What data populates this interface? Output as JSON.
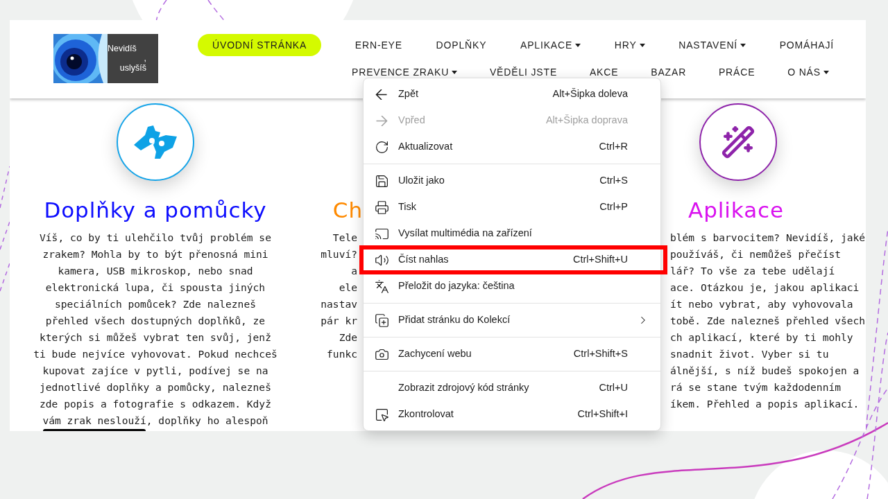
{
  "logo": {
    "lines": [
      "Nevidíš",
      ",",
      "uslyšíš"
    ]
  },
  "nav": {
    "first_line": [
      {
        "label": "ÚVODNÍ STRÁNKA",
        "selected": true,
        "dropdown": false
      },
      {
        "label": "ERN-EYE",
        "selected": false,
        "dropdown": false
      },
      {
        "label": "DOPLŇKY",
        "selected": false,
        "dropdown": false
      },
      {
        "label": "APLIKACE",
        "selected": false,
        "dropdown": true
      },
      {
        "label": "HRY",
        "selected": false,
        "dropdown": true
      },
      {
        "label": "NASTAVENÍ",
        "selected": false,
        "dropdown": true
      },
      {
        "label": "POMÁHAJÍ",
        "selected": false,
        "dropdown": false
      }
    ],
    "second_line": [
      {
        "label": "PREVENCE ZRAKU",
        "selected": false,
        "dropdown": true
      },
      {
        "label": "VĚDĚLI JSTE",
        "selected": false,
        "dropdown": false
      },
      {
        "label": "AKCE",
        "selected": false,
        "dropdown": false
      },
      {
        "label": "BAZAR",
        "selected": false,
        "dropdown": false
      },
      {
        "label": "PRÁCE",
        "selected": false,
        "dropdown": false
      },
      {
        "label": "O NÁS",
        "selected": false,
        "dropdown": true
      }
    ]
  },
  "columns": [
    {
      "kind": "full",
      "title": "Doplňky a pomůcky",
      "color": "#0d0dff",
      "lines": [
        "Víš, co by ti ulehčilo tvůj problém se",
        "zrakem? Mohla by to být přenosná mini",
        "kamera, USB mikroskop, nebo snad",
        "elektronická lupa, či spousta jiných",
        "speciálních pomůcek? Zde nalezneš",
        "přehled všech dostupných doplňků, ze",
        "kterých si můžeš vybrat ten svůj, jenž",
        "ti bude nejvíce vyhovovat. Pokud nechceš",
        "kupovat zajíce v pytli, podívej se na",
        "jednotlivé doplňky a pomůcky, nalezneš",
        "zde popis a fotografie s odkazem. Když",
        "vám zrak neslouží, doplňky ho alespoň"
      ]
    },
    {
      "kind": "cut-right",
      "title": "Ch",
      "color": "#ff8a00",
      "lines": [
        "Tele",
        "mluví?",
        "a",
        "ele",
        "nastav",
        "pár kr",
        "Zde",
        "funkc"
      ]
    },
    {
      "kind": "cut-left",
      "title": "Aplikace",
      "color": "#d912ef",
      "lines": [
        "blém s barvocitem? Nevidíš, jaké",
        "používáš, či nemůžeš přečíst",
        "lář? To vše za tebe udělají",
        "ace. Otázkou je, jakou aplikaci",
        "ít nebo vybrat, aby vyhovovala",
        "tobě. Zde nalezneš přehled všech",
        "ch aplikací, které by ti mohly",
        "snadnit život. Vyber si tu",
        "álnější, s níž budeš spokojen a",
        "rá se stane tvým každodenním",
        "íkem. Přehled a popis aplikací."
      ]
    }
  ],
  "context_menu": {
    "groups": [
      [
        {
          "label": "Zpět",
          "shortcut": "Alt+Šipka doleva",
          "disabled": false,
          "highlighted": false,
          "submenu": false
        },
        {
          "label": "Vpřed",
          "shortcut": "Alt+Šipka doprava",
          "disabled": true,
          "highlighted": false,
          "submenu": false
        },
        {
          "label": "Aktualizovat",
          "shortcut": "Ctrl+R",
          "disabled": false,
          "highlighted": false,
          "submenu": false
        }
      ],
      [
        {
          "label": "Uložit jako",
          "shortcut": "Ctrl+S",
          "disabled": false,
          "highlighted": false,
          "submenu": false
        },
        {
          "label": "Tisk",
          "shortcut": "Ctrl+P",
          "disabled": false,
          "highlighted": false,
          "submenu": false
        },
        {
          "label": "Vysílat multimédia na zařízení",
          "disabled": false,
          "highlighted": false,
          "submenu": false
        },
        {
          "label": "Číst nahlas",
          "shortcut": "Ctrl+Shift+U",
          "disabled": false,
          "highlighted": true,
          "submenu": false
        },
        {
          "label": "Přeložit do jazyka: čeština",
          "disabled": false,
          "highlighted": false,
          "submenu": false
        }
      ],
      [
        {
          "label": "Přidat stránku do Kolekcí",
          "disabled": false,
          "highlighted": false,
          "submenu": true
        }
      ],
      [
        {
          "label": "Zachycení webu",
          "shortcut": "Ctrl+Shift+S",
          "disabled": false,
          "highlighted": false,
          "submenu": false
        }
      ],
      [
        {
          "label": "Zobrazit zdrojový kód stránky",
          "shortcut": "Ctrl+U",
          "disabled": false,
          "highlighted": false,
          "submenu": false
        },
        {
          "label": "Zkontrolovat",
          "shortcut": "Ctrl+Shift+I",
          "disabled": false,
          "highlighted": false,
          "submenu": false
        }
      ]
    ]
  }
}
